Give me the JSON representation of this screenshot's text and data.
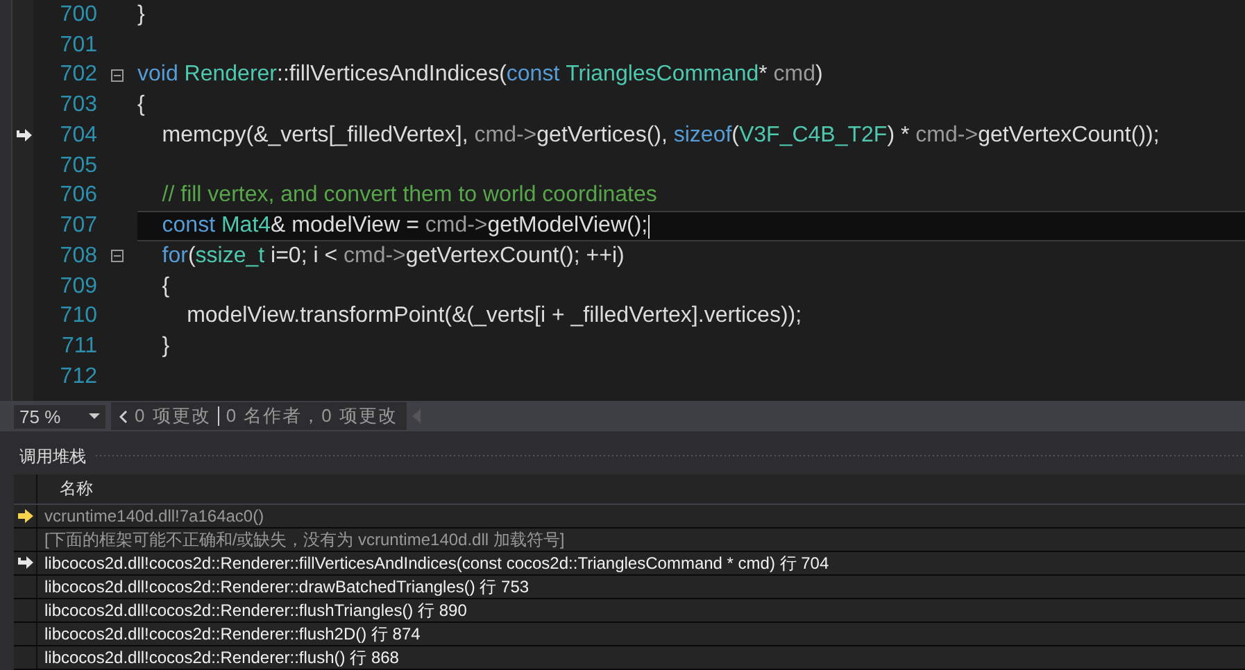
{
  "editor": {
    "lines": [
      {
        "number": "700",
        "tokens": [
          {
            "kind": "plain",
            "text": "}"
          }
        ]
      },
      {
        "number": "701"
      },
      {
        "number": "702",
        "foldable": true,
        "tokens": [
          {
            "kind": "kw",
            "text": "void "
          },
          {
            "kind": "type",
            "text": "Renderer"
          },
          {
            "kind": "plain",
            "text": "::fillVerticesAndIndices("
          },
          {
            "kind": "kw",
            "text": "const "
          },
          {
            "kind": "type",
            "text": "TrianglesCommand"
          },
          {
            "kind": "plain",
            "text": "* "
          },
          {
            "kind": "param",
            "text": "cmd"
          },
          {
            "kind": "plain",
            "text": ")"
          }
        ]
      },
      {
        "number": "703",
        "tokens": [
          {
            "kind": "plain",
            "text": "{"
          }
        ]
      },
      {
        "number": "704",
        "return_point": true,
        "tokens": [
          {
            "kind": "plain",
            "text": "    memcpy(&_verts[_filledVertex], "
          },
          {
            "kind": "param",
            "text": "cmd->"
          },
          {
            "kind": "plain",
            "text": "getVertices(), "
          },
          {
            "kind": "kw",
            "text": "sizeof"
          },
          {
            "kind": "plain",
            "text": "("
          },
          {
            "kind": "type",
            "text": "V3F_C4B_T2F"
          },
          {
            "kind": "plain",
            "text": ") * "
          },
          {
            "kind": "param",
            "text": "cmd->"
          },
          {
            "kind": "plain",
            "text": "getVertexCount());"
          }
        ]
      },
      {
        "number": "705"
      },
      {
        "number": "706",
        "tokens": [
          {
            "kind": "comment",
            "text": "    // fill vertex, and convert them to world coordinates"
          }
        ]
      },
      {
        "number": "707",
        "current": true,
        "tokens": [
          {
            "kind": "kw",
            "text": "    const "
          },
          {
            "kind": "type",
            "text": "Mat4"
          },
          {
            "kind": "plain",
            "text": "& modelView = "
          },
          {
            "kind": "param",
            "text": "cmd->"
          },
          {
            "kind": "plain",
            "text": "getModelView();"
          }
        ]
      },
      {
        "number": "708",
        "foldable": true,
        "tokens": [
          {
            "kind": "kw",
            "text": "    for"
          },
          {
            "kind": "plain",
            "text": "("
          },
          {
            "kind": "type",
            "text": "ssize_t"
          },
          {
            "kind": "plain",
            "text": " i=0; i < "
          },
          {
            "kind": "param",
            "text": "cmd->"
          },
          {
            "kind": "plain",
            "text": "getVertexCount(); ++i)"
          }
        ]
      },
      {
        "number": "709",
        "tokens": [
          {
            "kind": "plain",
            "text": "    {"
          }
        ]
      },
      {
        "number": "710",
        "tokens": [
          {
            "kind": "plain",
            "text": "        modelView.transformPoint(&(_verts[i + _filledVertex].vertices));"
          }
        ]
      },
      {
        "number": "711",
        "tokens": [
          {
            "kind": "plain",
            "text": "    }"
          }
        ]
      },
      {
        "number": "712"
      }
    ]
  },
  "status_bar": {
    "zoom": "75 %",
    "changes": "0 项更改",
    "authors": "0 名作者，0 项更改"
  },
  "call_stack": {
    "title": "调用堆栈",
    "column": "名称",
    "rows": [
      {
        "kind": "current",
        "greyed": true,
        "text": "vcruntime140d.dll!7a164ac0()"
      },
      {
        "kind": "plain",
        "greyed": true,
        "text": "[下面的框架可能不正确和/或缺失，没有为 vcruntime140d.dll 加载符号]"
      },
      {
        "kind": "caller",
        "greyed": false,
        "text": "libcocos2d.dll!cocos2d::Renderer::fillVerticesAndIndices(const cocos2d::TrianglesCommand * cmd) 行 704"
      },
      {
        "kind": "plain",
        "greyed": false,
        "text": "libcocos2d.dll!cocos2d::Renderer::drawBatchedTriangles() 行 753"
      },
      {
        "kind": "plain",
        "greyed": false,
        "text": "libcocos2d.dll!cocos2d::Renderer::flushTriangles() 行 890"
      },
      {
        "kind": "plain",
        "greyed": false,
        "text": "libcocos2d.dll!cocos2d::Renderer::flush2D() 行 874"
      },
      {
        "kind": "plain",
        "greyed": false,
        "text": "libcocos2d.dll!cocos2d::Renderer::flush() 行 868"
      }
    ]
  }
}
